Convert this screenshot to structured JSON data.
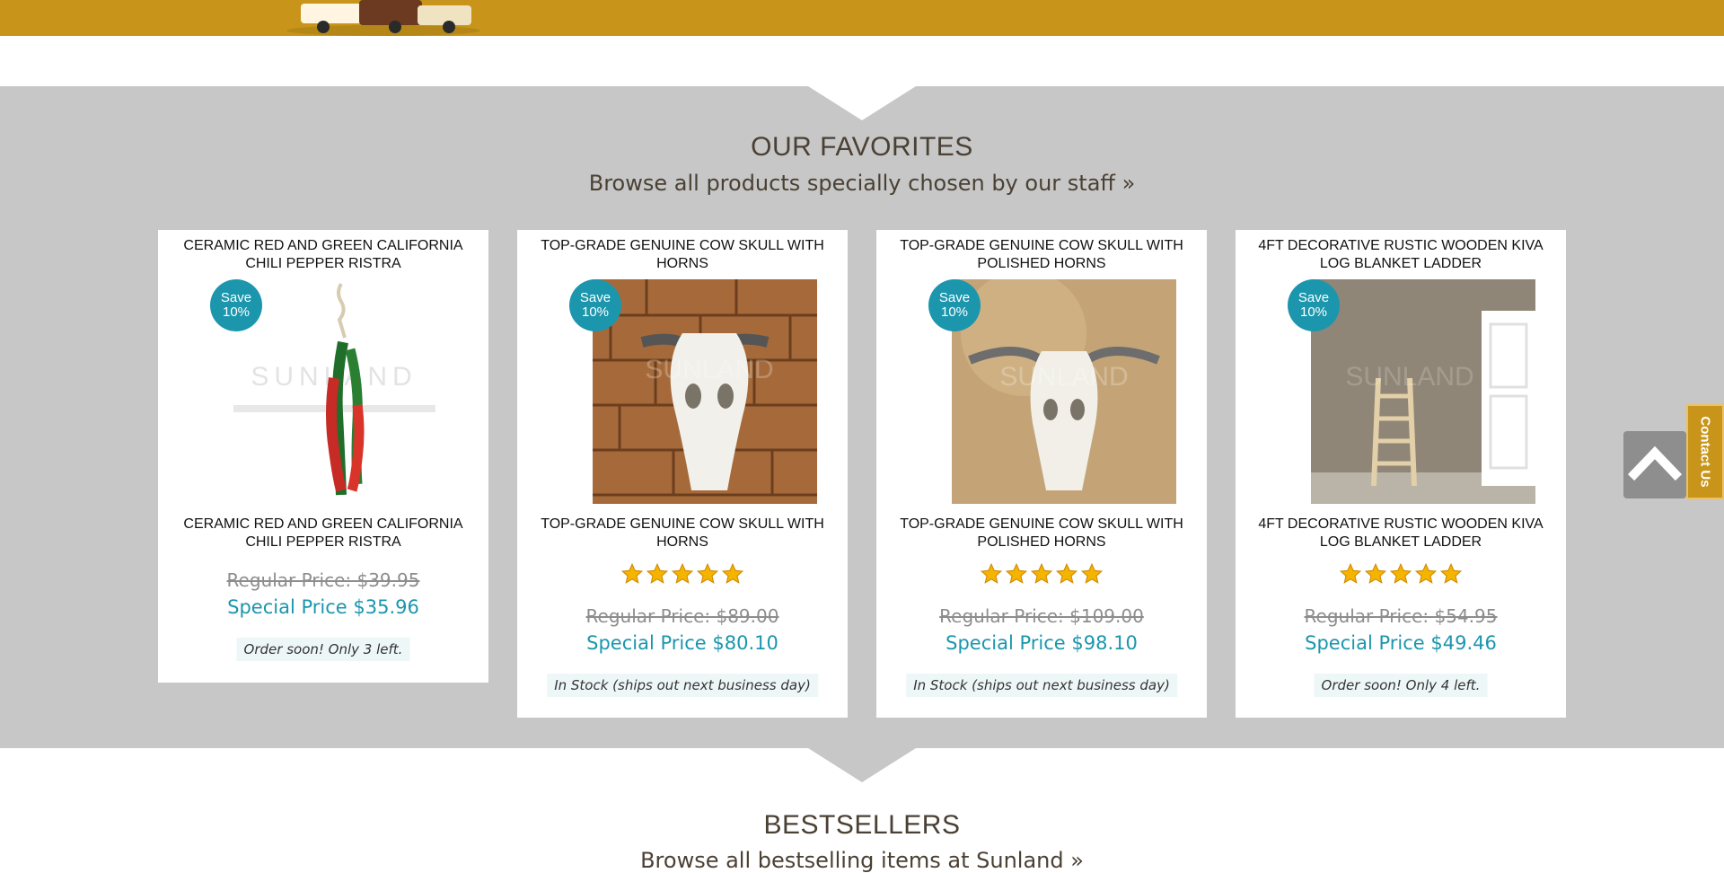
{
  "sections": {
    "favorites": {
      "title": "OUR FAVORITES",
      "subtitle": "Browse all products specially chosen by our staff »"
    },
    "bestsellers": {
      "title": "BESTSELLERS",
      "subtitle": "Browse all bestselling items at Sunland »"
    }
  },
  "products": [
    {
      "title": "CERAMIC RED AND GREEN CALIFORNIA CHILI PEPPER RISTRA",
      "badge_line1": "Save",
      "badge_line2": "10%",
      "rating": 0,
      "regular_price": "Regular Price: $39.95",
      "special_price": "Special Price $35.96",
      "stock": "Order soon! Only 3 left.",
      "image_watermark": "SUNLAND"
    },
    {
      "title": "TOP-GRADE GENUINE COW SKULL WITH HORNS",
      "badge_line1": "Save",
      "badge_line2": "10%",
      "rating": 5,
      "regular_price": "Regular Price: $89.00",
      "special_price": "Special Price $80.10",
      "stock": "In Stock (ships out next business day)",
      "image_watermark": "SUNLAND"
    },
    {
      "title": "TOP-GRADE GENUINE COW SKULL WITH POLISHED HORNS",
      "badge_line1": "Save",
      "badge_line2": "10%",
      "rating": 5,
      "regular_price": "Regular Price: $109.00",
      "special_price": "Special Price $98.10",
      "stock": "In Stock (ships out next business day)",
      "image_watermark": "SUNLAND"
    },
    {
      "title": "4FT DECORATIVE RUSTIC WOODEN KIVA LOG BLANKET LADDER",
      "badge_line1": "Save",
      "badge_line2": "10%",
      "rating": 5,
      "regular_price": "Regular Price: $54.95",
      "special_price": "Special Price $49.46",
      "stock": "Order soon! Only 4 left.",
      "image_watermark": "SUNLAND"
    }
  ],
  "floating": {
    "contact_label": "Contact Us",
    "scroll_top_icon": "chevron-up-icon"
  },
  "colors": {
    "header_gold": "#c8951a",
    "section_gray": "#c7c7c7",
    "accent_teal": "#1b96ad",
    "star_gold": "#f5b400"
  }
}
